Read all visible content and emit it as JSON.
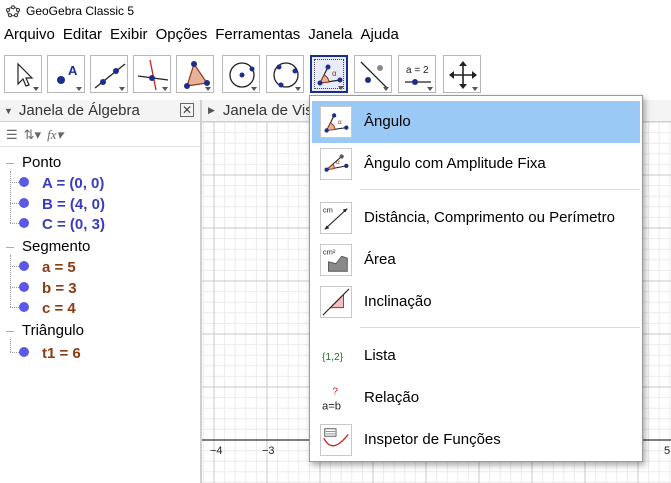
{
  "window": {
    "title": "GeoGebra Classic 5"
  },
  "menu": [
    "Arquivo",
    "Editar",
    "Exibir",
    "Opções",
    "Ferramentas",
    "Janela",
    "Ajuda"
  ],
  "toolbar": {
    "tools": [
      {
        "icon": "move-icon"
      },
      {
        "icon": "point-icon",
        "label": "A"
      },
      {
        "icon": "line-icon"
      },
      {
        "icon": "perpendicular-line-icon"
      },
      {
        "icon": "polygon-icon"
      },
      {
        "icon": "circle-center-point-icon"
      },
      {
        "icon": "circle-three-points-icon"
      },
      {
        "icon": "angle-icon",
        "selected": true
      },
      {
        "icon": "reflect-icon"
      },
      {
        "icon": "slider-icon",
        "label": "a = 2"
      },
      {
        "icon": "move-graphics-view-icon"
      }
    ]
  },
  "algebra": {
    "title": "Janela de Álgebra",
    "groups": [
      {
        "name": "Ponto",
        "items": [
          "A = (0, 0)",
          "B = (4, 0)",
          "C = (0, 3)"
        ]
      },
      {
        "name": "Segmento",
        "items": [
          "a = 5",
          "b = 3",
          "c = 4"
        ]
      },
      {
        "name": "Triângulo",
        "items": [
          "t1 = 6"
        ]
      }
    ]
  },
  "graphics": {
    "title": "Janela de Visualização",
    "axis_labels": [
      "−4",
      "−3",
      "5"
    ]
  },
  "dropdown": {
    "items": [
      {
        "label": "Ângulo",
        "icon": "angle-icon",
        "highlighted": true
      },
      {
        "label": "Ângulo com Amplitude Fixa",
        "icon": "angle-fixed-icon"
      },
      {
        "label": "Distância, Comprimento ou Perímetro",
        "icon": "distance-icon"
      },
      {
        "label": "Área",
        "icon": "area-icon"
      },
      {
        "label": "Inclinação",
        "icon": "slope-icon"
      },
      {
        "label": "Lista",
        "icon": "list-icon"
      },
      {
        "label": "Relação",
        "icon": "relation-icon"
      },
      {
        "label": "Inspetor de Funções",
        "icon": "function-inspector-icon"
      }
    ],
    "icon_text": {
      "distance": "cm",
      "area": "cm²",
      "list": "{1,2}",
      "relation_q": "?",
      "relation": "a=b"
    }
  },
  "colors": {
    "highlight": "#99c9f4",
    "point": "#3b3bbd",
    "segment": "#8b3a12"
  }
}
